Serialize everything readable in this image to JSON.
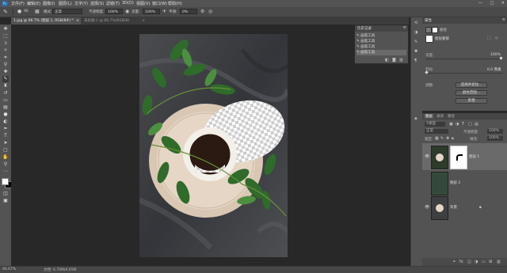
{
  "app": {
    "name": "Photoshop",
    "logo_text": "Ps"
  },
  "menubar": {
    "items": [
      "文件(F)",
      "编辑(E)",
      "图像(I)",
      "图层(L)",
      "文字(Y)",
      "选择(S)",
      "滤镜(T)",
      "3D(D)",
      "视图(V)",
      "窗口(W)",
      "帮助(H)"
    ]
  },
  "window_controls": {
    "minimize": "—",
    "maximize": "□",
    "close": "✕"
  },
  "options": {
    "brush_size": "96",
    "mode_label": "模式:",
    "mode_value": "正常",
    "opacity_label": "不透明度:",
    "opacity_value": "100%",
    "flow_label": "流量:",
    "flow_value": "100%",
    "smooth_label": "平滑:",
    "smooth_value": "0%"
  },
  "tabs": [
    {
      "label": "1.jpg @ 66.7% (图层 1, RGB/8#) *",
      "active": true,
      "close": "×"
    },
    {
      "label": "未标题-1 @ 66.7%(RGB/8)",
      "active": false,
      "close": "×"
    }
  ],
  "history_panel": {
    "title": "历史记录",
    "items": [
      "画笔工具",
      "画笔工具",
      "画笔工具",
      "画笔工具"
    ],
    "active_index": 3
  },
  "properties_panel": {
    "title": "属性",
    "section": "蒙版",
    "subtitle": "图层蒙版",
    "density_label": "浓度:",
    "density_value": "100%",
    "feather_label": "羽化:",
    "feather_value": "0.0 像素",
    "refine_label": "调整:",
    "buttons": [
      "选择并遮住...",
      "颜色范围...",
      "反相"
    ]
  },
  "layers_panel": {
    "tabs": [
      "图层",
      "通道",
      "路径"
    ],
    "kind_label": "类型",
    "blend_mode": "正常",
    "opacity_label": "不透明度:",
    "opacity_value": "100%",
    "lock_label": "锁定:",
    "fill_label": "填充:",
    "fill_value": "100%",
    "layers": [
      {
        "name": "图层 1",
        "visible": true,
        "has_mask": true,
        "selected": true
      },
      {
        "name": "图层 2",
        "visible": false,
        "has_mask": false,
        "selected": false
      },
      {
        "name": "背景",
        "visible": true,
        "has_mask": false,
        "selected": false,
        "locked": true
      }
    ]
  },
  "statusbar": {
    "zoom": "66.67%",
    "doc": "文档: 6.70M/4.05M"
  },
  "colors": {
    "accent": "#2a6aa8",
    "panel": "#535353",
    "canvas_bg": "#282828"
  }
}
